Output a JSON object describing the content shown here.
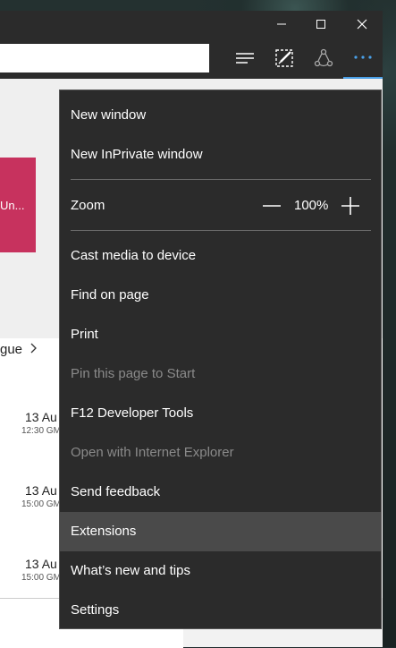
{
  "page": {
    "tile_text": "Un...",
    "league_link": "gue",
    "matches": [
      {
        "date": "13 Au",
        "time": "12:30 GM"
      },
      {
        "date": "13 Au",
        "time": "15:00 GM"
      },
      {
        "date": "13 Au",
        "time": "15:00 GM"
      }
    ]
  },
  "menu": {
    "items_top": [
      {
        "label": "New window"
      },
      {
        "label": "New InPrivate window"
      }
    ],
    "zoom": {
      "label": "Zoom",
      "value": "100%"
    },
    "items_bottom": [
      {
        "label": "Cast media to device"
      },
      {
        "label": "Find on page"
      },
      {
        "label": "Print"
      },
      {
        "label": "Pin this page to Start"
      },
      {
        "label": "F12 Developer Tools"
      },
      {
        "label": "Open with Internet Explorer"
      },
      {
        "label": "Send feedback"
      },
      {
        "label": "Extensions"
      },
      {
        "label": "What’s new and tips"
      },
      {
        "label": "Settings"
      }
    ]
  },
  "colors": {
    "accent": "#4aa0e8",
    "menu_bg": "#2b2b2b",
    "hover_bg": "#4a4a4a",
    "tile": "#c7325e"
  },
  "icons": [
    "minimize-icon",
    "maximize-icon",
    "close-icon",
    "hub-icon",
    "web-note-icon",
    "share-icon",
    "more-icon",
    "zoom-out-icon",
    "zoom-in-icon",
    "chevron-right-icon"
  ]
}
